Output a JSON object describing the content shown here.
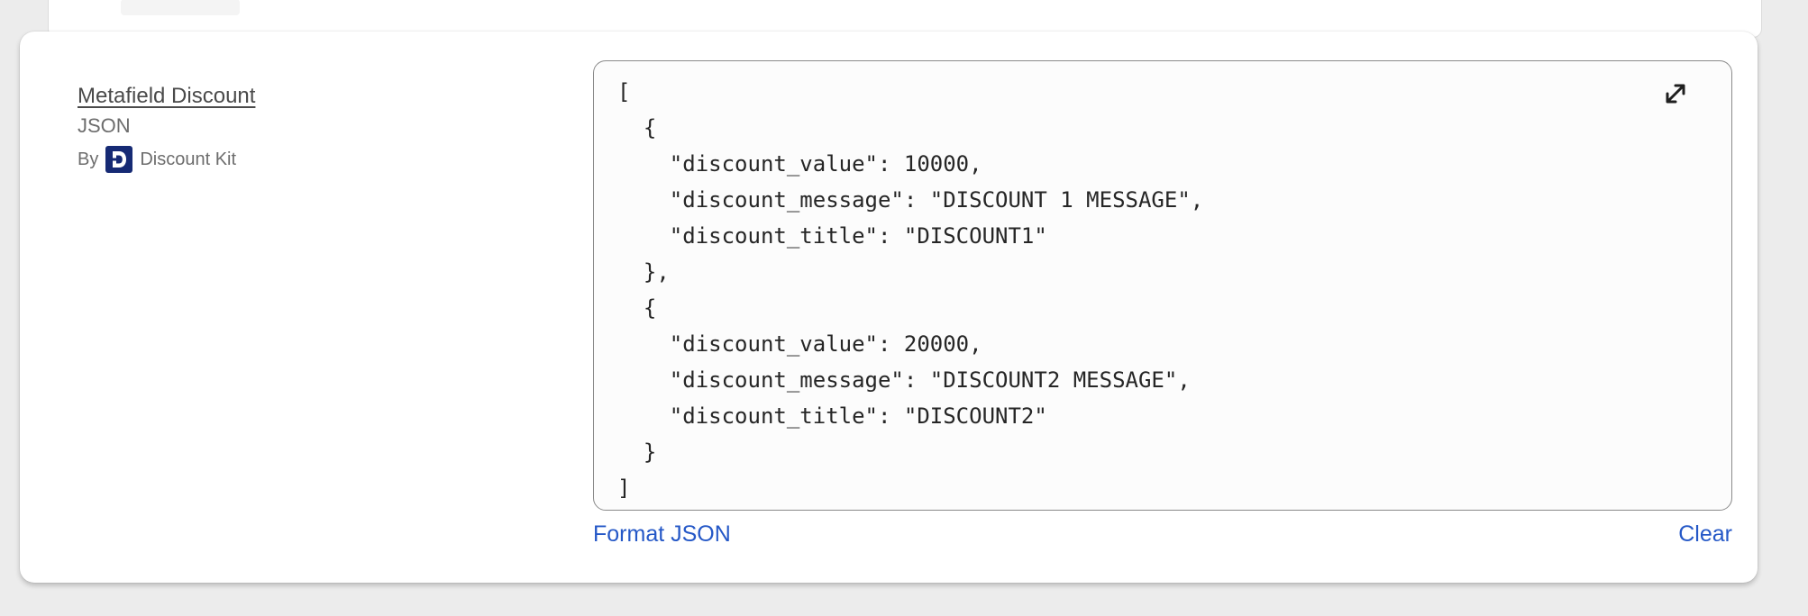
{
  "metafield": {
    "title": "Metafield Discount",
    "type": "JSON",
    "by_label": "By",
    "app_name": "Discount Kit",
    "app_logo_letter": "D"
  },
  "editor": {
    "lines": [
      "[",
      "  {",
      "    \"discount_value\": 10000,",
      "    \"discount_message\": \"DISCOUNT 1 MESSAGE\",",
      "    \"discount_title\": \"DISCOUNT1\"",
      "  },",
      "  {",
      "    \"discount_value\": 20000,",
      "    \"discount_message\": \"DISCOUNT2 MESSAGE\",",
      "    \"discount_title\": \"DISCOUNT2\"",
      "  }",
      "]"
    ],
    "expand_icon": "expand-arrows-icon"
  },
  "actions": {
    "format_label": "Format JSON",
    "clear_label": "Clear"
  },
  "colors": {
    "link": "#2558c7",
    "app_logo_bg": "#162a74"
  }
}
